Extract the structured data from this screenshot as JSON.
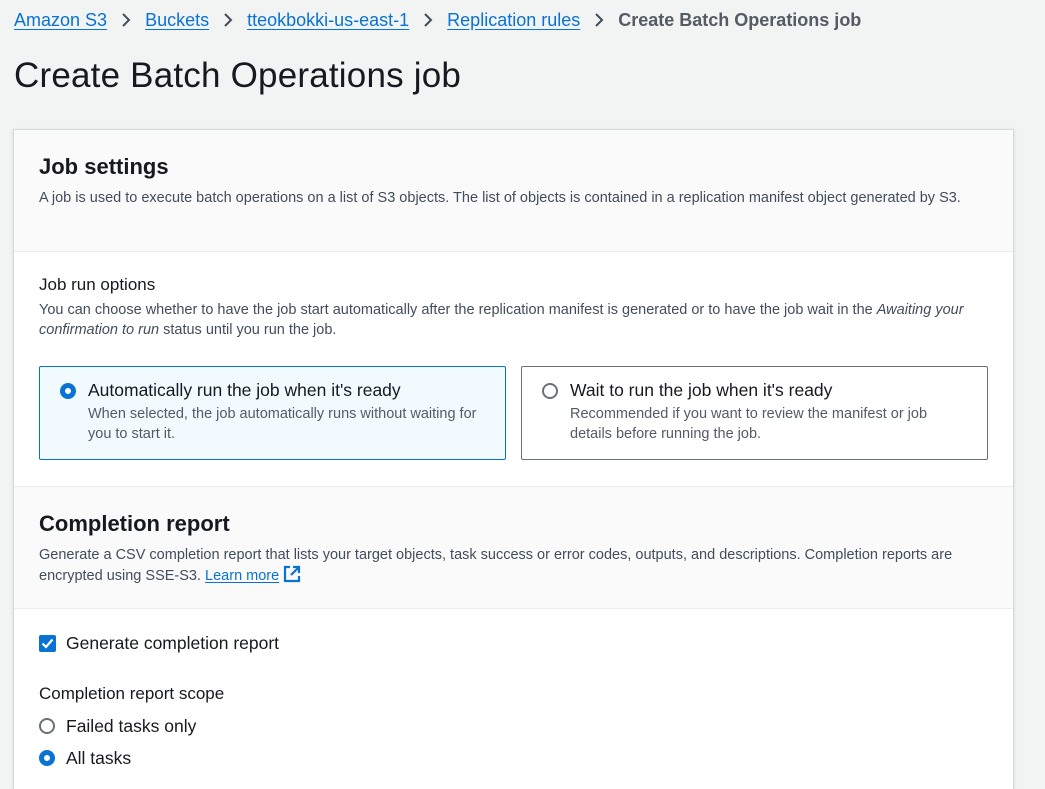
{
  "breadcrumb": {
    "items": [
      "Amazon S3",
      "Buckets",
      "tteokbokki-us-east-1",
      "Replication rules"
    ],
    "current": "Create Batch Operations job"
  },
  "page": {
    "title": "Create Batch Operations job"
  },
  "job_settings": {
    "title": "Job settings",
    "description": "A job is used to execute batch operations on a list of S3 objects. The list of objects is contained in a replication manifest object generated by S3.",
    "run_options": {
      "label": "Job run options",
      "description_prefix": "You can choose whether to have the job start automatically after the replication manifest is generated or to have the job wait in the ",
      "description_italic": "Awaiting your confirmation to run",
      "description_suffix": " status until you run the job.",
      "options": [
        {
          "title": "Automatically run the job when it's ready",
          "description": "When selected, the job automatically runs without waiting for you to start it.",
          "selected": true
        },
        {
          "title": "Wait to run the job when it's ready",
          "description": "Recommended if you want to review the manifest or job details before running the job.",
          "selected": false
        }
      ]
    }
  },
  "completion_report": {
    "title": "Completion report",
    "description": "Generate a CSV completion report that lists your target objects, task success or error codes, outputs, and descriptions. Completion reports are encrypted using SSE-S3.",
    "learn_more": "Learn more",
    "generate_checkbox": {
      "label": "Generate completion report",
      "checked": true
    },
    "scope": {
      "label": "Completion report scope",
      "options": [
        {
          "label": "Failed tasks only",
          "selected": false
        },
        {
          "label": "All tasks",
          "selected": true
        }
      ]
    }
  },
  "icons": {
    "breadcrumb_separator": "chevron-right-icon",
    "external_link": "external-link-icon",
    "checkbox": "checkmark-icon"
  },
  "colors": {
    "link": "#0972d3",
    "selected_tile_bg": "#f1faff",
    "page_bg": "#f2f3f3"
  }
}
